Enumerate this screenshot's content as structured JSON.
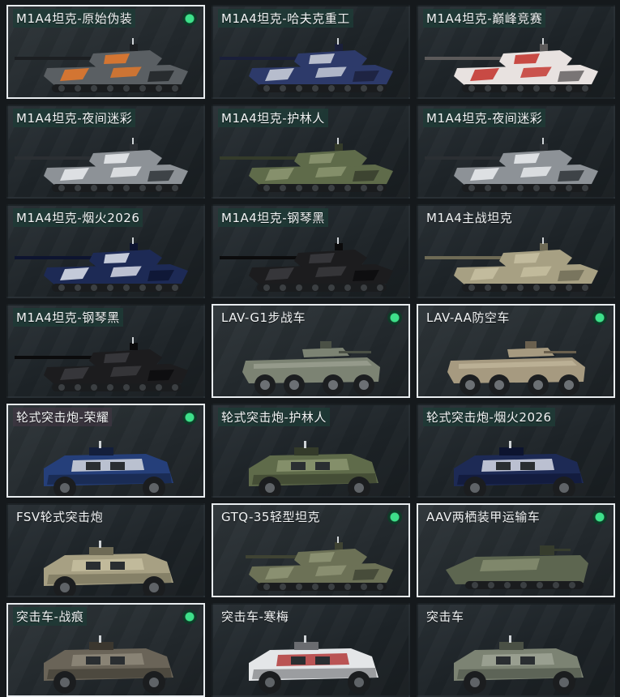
{
  "vehicles": [
    {
      "name": "M1A4坦克-原始伪装",
      "selected": true,
      "equipped": true,
      "kind": "tank",
      "skin": "orange-camo",
      "tag": true
    },
    {
      "name": "M1A4坦克-哈夫克重工",
      "selected": false,
      "equipped": false,
      "kind": "tank",
      "skin": "haavk-blue",
      "tag": true
    },
    {
      "name": "M1A4坦克-巅峰竞赛",
      "selected": false,
      "equipped": false,
      "kind": "tank",
      "skin": "red-white",
      "tag": true
    },
    {
      "name": "M1A4坦克-夜间迷彩",
      "selected": false,
      "equipped": false,
      "kind": "tank",
      "skin": "night-camo",
      "tag": true
    },
    {
      "name": "M1A4坦克-护林人",
      "selected": false,
      "equipped": false,
      "kind": "tank",
      "skin": "forest",
      "tag": true
    },
    {
      "name": "M1A4坦克-夜间迷彩",
      "selected": false,
      "equipped": false,
      "kind": "tank",
      "skin": "night-camo",
      "tag": true
    },
    {
      "name": "M1A4坦克-烟火2026",
      "selected": false,
      "equipped": false,
      "kind": "tank",
      "skin": "firework-2026",
      "tag": true
    },
    {
      "name": "M1A4坦克-钢琴黑",
      "selected": false,
      "equipped": false,
      "kind": "tank",
      "skin": "piano-black",
      "tag": true
    },
    {
      "name": "M1A4主战坦克",
      "selected": false,
      "equipped": false,
      "kind": "tank",
      "skin": "desert",
      "tag": false
    },
    {
      "name": "M1A4坦克-钢琴黑",
      "selected": false,
      "equipped": false,
      "kind": "tank",
      "skin": "piano-black",
      "tag": true
    },
    {
      "name": "LAV-G1步战车",
      "selected": true,
      "equipped": true,
      "kind": "ifv",
      "skin": "olive-grey",
      "tag": false
    },
    {
      "name": "LAV-AA防空车",
      "selected": true,
      "equipped": true,
      "kind": "ifv",
      "skin": "tan",
      "tag": false
    },
    {
      "name": "轮式突击炮-荣耀",
      "selected": true,
      "equipped": true,
      "kind": "armored-car",
      "skin": "glory-blue",
      "tag": true
    },
    {
      "name": "轮式突击炮-护林人",
      "selected": false,
      "equipped": false,
      "kind": "armored-car",
      "skin": "forest",
      "tag": true
    },
    {
      "name": "轮式突击炮-烟火2026",
      "selected": false,
      "equipped": false,
      "kind": "armored-car",
      "skin": "firework-2026",
      "tag": true
    },
    {
      "name": "FSV轮式突击炮",
      "selected": false,
      "equipped": false,
      "kind": "armored-car",
      "skin": "desert",
      "tag": false
    },
    {
      "name": "GTQ-35轻型坦克",
      "selected": true,
      "equipped": true,
      "kind": "light-tank",
      "skin": "olive",
      "tag": false
    },
    {
      "name": "AAV两栖装甲运输车",
      "selected": true,
      "equipped": true,
      "kind": "amphibious",
      "skin": "olive-camo",
      "tag": false
    },
    {
      "name": "突击车-战痕",
      "selected": true,
      "equipped": true,
      "kind": "assault-car",
      "skin": "battle-scar",
      "tag": true
    },
    {
      "name": "突击车-寒梅",
      "selected": false,
      "equipped": false,
      "kind": "assault-car",
      "skin": "white-plum",
      "tag": false
    },
    {
      "name": "突击车",
      "selected": false,
      "equipped": false,
      "kind": "assault-car",
      "skin": "olive-grey",
      "tag": false
    }
  ],
  "skin_colors": {
    "orange-camo": [
      "#5a5f63",
      "#e0782c",
      "#1c1f22"
    ],
    "haavk-blue": [
      "#2d3a6a",
      "#c7ccd8",
      "#1a1f3a"
    ],
    "red-white": [
      "#e8e2e0",
      "#c43a33",
      "#5c5a5a"
    ],
    "night-camo": [
      "#8d9297",
      "#e6e9eb",
      "#2b2f33"
    ],
    "forest": [
      "#5f6b4a",
      "#8b9570",
      "#343b2a"
    ],
    "firework-2026": [
      "#1d2a55",
      "#d7dbe8",
      "#0d1430"
    ],
    "piano-black": [
      "#1c1c1e",
      "#3a3a3d",
      "#0b0b0c"
    ],
    "desert": [
      "#a7a083",
      "#c5bea0",
      "#6e6a55"
    ],
    "olive-grey": [
      "#7c8373",
      "#9fa495",
      "#4a5045"
    ],
    "tan": [
      "#a69a80",
      "#c4b99e",
      "#6a604e"
    ],
    "glory-blue": [
      "#253f7a",
      "#d5d8df",
      "#141f3c"
    ],
    "olive": [
      "#6c7156",
      "#8e9374",
      "#3f4333"
    ],
    "olive-camo": [
      "#5d6650",
      "#858d70",
      "#363c2d"
    ],
    "battle-scar": [
      "#6a6458",
      "#8e887a",
      "#3b372f"
    ],
    "white-plum": [
      "#e4e6e8",
      "#b33a3a",
      "#6a6c70"
    ]
  },
  "accent_selected_border": "#e8ecef",
  "accent_equipped": "#3ee08a"
}
